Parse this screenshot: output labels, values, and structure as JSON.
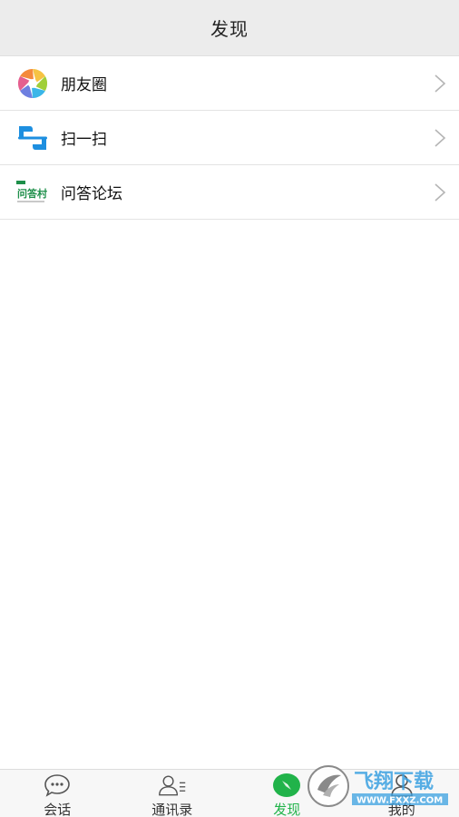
{
  "header": {
    "title": "发现"
  },
  "menu": {
    "items": [
      {
        "label": "朋友圈",
        "icon": "aperture-icon"
      },
      {
        "label": "扫一扫",
        "icon": "scan-icon"
      },
      {
        "label": "问答论坛",
        "icon": "qa-forum-logo-icon",
        "logo_text": "问答村"
      }
    ]
  },
  "tabbar": {
    "tabs": [
      {
        "label": "会话",
        "icon": "chat-bubble-icon",
        "active": false
      },
      {
        "label": "通讯录",
        "icon": "contacts-icon",
        "active": false
      },
      {
        "label": "发现",
        "icon": "compass-icon",
        "active": true
      },
      {
        "label": "我的",
        "icon": "profile-icon",
        "active": false
      }
    ]
  },
  "watermark": {
    "text_main": "飞翔下载",
    "text_url": "WWW.FXXZ.COM"
  },
  "colors": {
    "accent": "#21b34a",
    "header_bg": "#ececec",
    "tab_bg": "#f7f7f7"
  }
}
